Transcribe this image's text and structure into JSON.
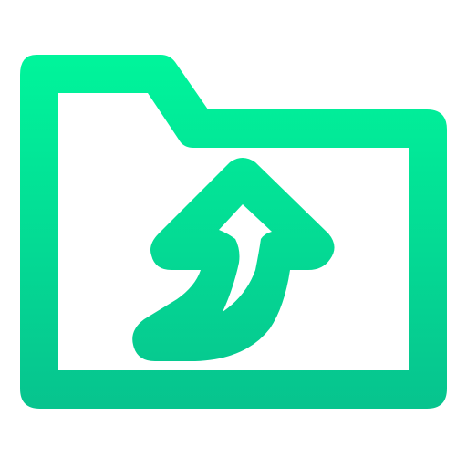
{
  "icon": {
    "name": "folder-upload-icon",
    "colors": {
      "gradient_top": "#00F59B",
      "gradient_bottom": "#07C38E",
      "background": "#FFFFFF"
    }
  }
}
